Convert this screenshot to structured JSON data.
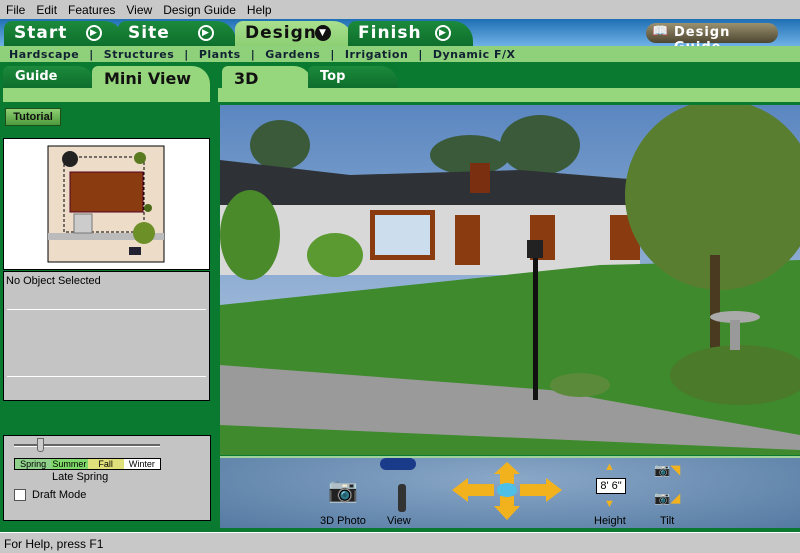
{
  "menu": [
    "File",
    "Edit",
    "Features",
    "View",
    "Design Guide",
    "Help"
  ],
  "main_tabs": [
    {
      "label": "Start",
      "icon": "play-icon"
    },
    {
      "label": "Site",
      "icon": "play-icon"
    },
    {
      "label": "Design",
      "icon": "dropdown-icon"
    },
    {
      "label": "Finish",
      "icon": "play-icon"
    }
  ],
  "design_guide_button": "Design Guide",
  "subnav": [
    "Hardscape",
    "Structures",
    "Plants",
    "Gardens",
    "Irrigation",
    "Dynamic F/X"
  ],
  "left_tabs": [
    "Guide",
    "Mini View"
  ],
  "view_tabs": [
    "3D",
    "Top"
  ],
  "tutorial_button": "Tutorial",
  "info_text": "No Object Selected",
  "season": {
    "labels": [
      "Spring",
      "Summer",
      "Fall",
      "Winter"
    ],
    "current": "Late Spring",
    "slider_fraction": 0.18
  },
  "draft_mode": {
    "label": "Draft Mode",
    "checked": false
  },
  "controls": {
    "photo": "3D Photo",
    "view": "View",
    "height_label": "Height",
    "height_value": "8' 6\"",
    "tilt": "Tilt"
  },
  "status": "For Help, press F1",
  "colors": {
    "green_dark": "#0b7a31",
    "green_light": "#96d67c",
    "control_bar": "#557aa2"
  }
}
